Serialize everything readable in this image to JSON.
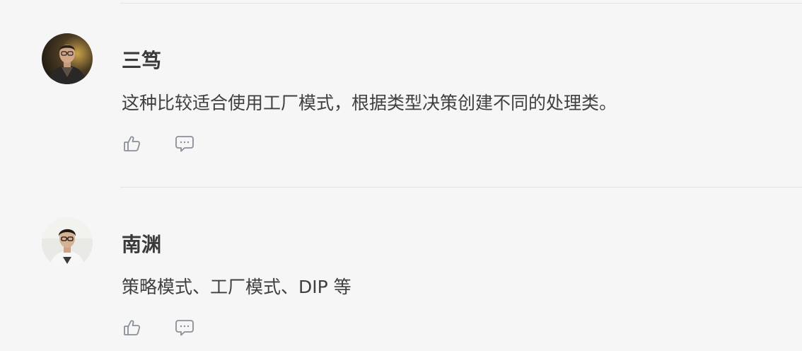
{
  "comments": [
    {
      "author": "三笃",
      "text": "这种比较适合使用工厂模式，根据类型决策创建不同的处理类。",
      "like_icon": "thumbs-up-icon",
      "reply_icon": "comment-bubble-icon"
    },
    {
      "author": "南渊",
      "text": "策略模式、工厂模式、DIP 等",
      "like_icon": "thumbs-up-icon",
      "reply_icon": "comment-bubble-icon"
    }
  ],
  "colors": {
    "background": "#f6f6f6",
    "divider": "#e3e3e3",
    "author_text": "#3a3a3a",
    "body_text": "#3f3f3f",
    "icon": "#8a8f98"
  }
}
